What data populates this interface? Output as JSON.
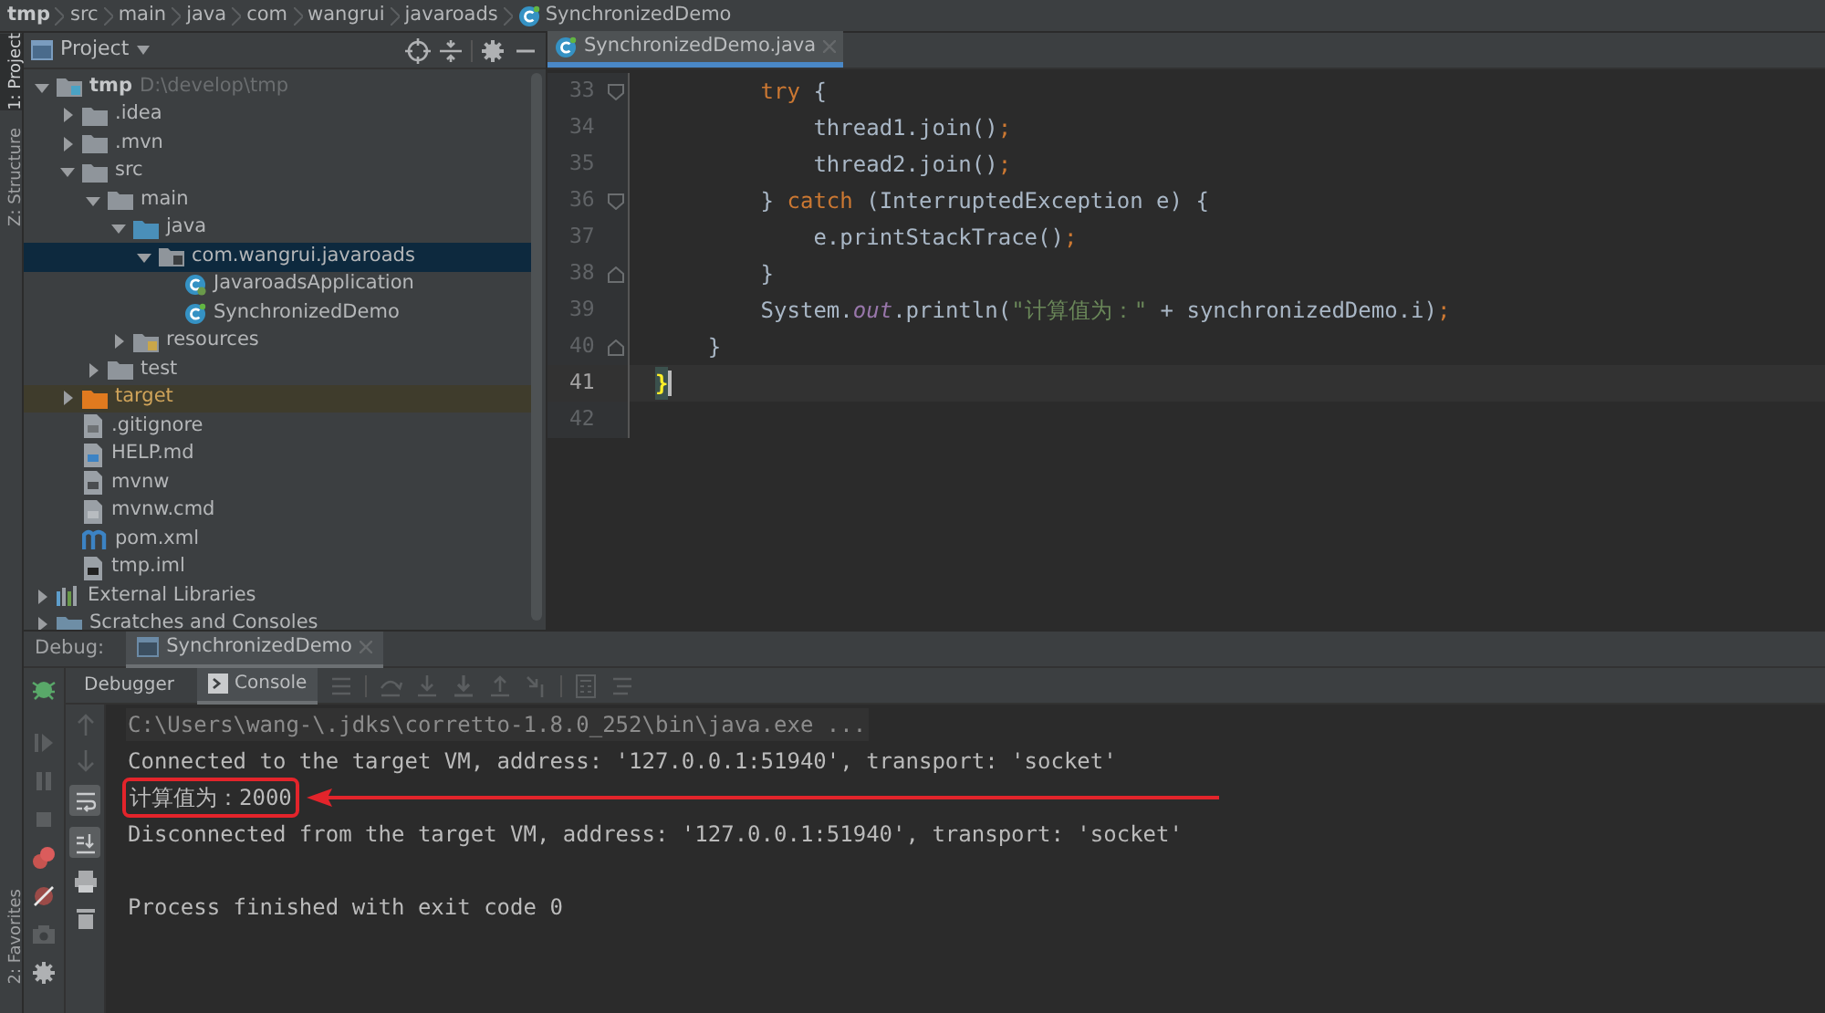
{
  "breadcrumbs": [
    {
      "label": "tmp",
      "kind": "root"
    },
    {
      "label": "src",
      "kind": "folder"
    },
    {
      "label": "main",
      "kind": "folder"
    },
    {
      "label": "java",
      "kind": "folder"
    },
    {
      "label": "com",
      "kind": "folder"
    },
    {
      "label": "wangrui",
      "kind": "folder"
    },
    {
      "label": "javaroads",
      "kind": "folder"
    },
    {
      "label": "SynchronizedDemo",
      "kind": "class"
    }
  ],
  "tool_strip": {
    "top": [
      {
        "label": "1: Project",
        "selected": true
      },
      {
        "label": "Z: Structure",
        "selected": false
      }
    ],
    "bottom": [
      {
        "label": "2: Favorites",
        "selected": false
      }
    ]
  },
  "project": {
    "title": "Project",
    "tree": [
      {
        "label": "tmp",
        "hint": "D:\\develop\\tmp",
        "kind": "module",
        "expanded": true,
        "selected": false,
        "children": [
          {
            "label": ".idea",
            "kind": "folder",
            "expanded": false,
            "selected": false
          },
          {
            "label": ".mvn",
            "kind": "folder",
            "expanded": false,
            "selected": false
          },
          {
            "label": "src",
            "kind": "folder",
            "expanded": true,
            "selected": false,
            "children": [
              {
                "label": "main",
                "kind": "folder",
                "expanded": true,
                "selected": false,
                "children": [
                  {
                    "label": "java",
                    "kind": "source",
                    "expanded": true,
                    "selected": false,
                    "children": [
                      {
                        "label": "com.wangrui.javaroads",
                        "kind": "package",
                        "expanded": true,
                        "selected": true,
                        "children": [
                          {
                            "label": "JavaroadsApplication",
                            "kind": "app-class",
                            "selected": false
                          },
                          {
                            "label": "SynchronizedDemo",
                            "kind": "class",
                            "selected": false
                          }
                        ]
                      }
                    ]
                  },
                  {
                    "label": "resources",
                    "kind": "resources",
                    "expanded": false,
                    "selected": false
                  }
                ]
              },
              {
                "label": "test",
                "kind": "folder",
                "expanded": false,
                "selected": false
              }
            ]
          },
          {
            "label": "target",
            "kind": "excluded",
            "expanded": false,
            "selected": false
          },
          {
            "label": ".gitignore",
            "kind": "ignore-file",
            "selected": false
          },
          {
            "label": "HELP.md",
            "kind": "markdown-file",
            "selected": false
          },
          {
            "label": "mvnw",
            "kind": "shell-file",
            "selected": false
          },
          {
            "label": "mvnw.cmd",
            "kind": "text-file",
            "selected": false
          },
          {
            "label": "pom.xml",
            "kind": "maven-file",
            "selected": false
          },
          {
            "label": "tmp.iml",
            "kind": "iml-file",
            "selected": false
          }
        ]
      },
      {
        "label": "External Libraries",
        "kind": "libraries",
        "expanded": false,
        "selected": false
      },
      {
        "label": "Scratches and Consoles",
        "kind": "scratches",
        "expanded": false,
        "selected": false
      }
    ]
  },
  "editor": {
    "tabs": [
      {
        "label": "SynchronizedDemo.java",
        "selected": true
      }
    ],
    "lines": [
      {
        "number": "33",
        "kind": "fold-start",
        "current": false,
        "tokens": [
          {
            "kind": "keyword",
            "text": "        try"
          },
          {
            "kind": "plain",
            "text": " {"
          }
        ]
      },
      {
        "number": "34",
        "kind": "plain",
        "current": false,
        "tokens": [
          {
            "kind": "plain",
            "text": "            thread1.join()"
          },
          {
            "kind": "keyword",
            "text": ";"
          }
        ]
      },
      {
        "number": "35",
        "kind": "plain",
        "current": false,
        "tokens": [
          {
            "kind": "plain",
            "text": "            thread2.join()"
          },
          {
            "kind": "keyword",
            "text": ";"
          }
        ]
      },
      {
        "number": "36",
        "kind": "fold-start",
        "current": false,
        "tokens": [
          {
            "kind": "plain",
            "text": "        } "
          },
          {
            "kind": "keyword",
            "text": "catch"
          },
          {
            "kind": "plain",
            "text": " (InterruptedException e) {"
          }
        ]
      },
      {
        "number": "37",
        "kind": "plain",
        "current": false,
        "tokens": [
          {
            "kind": "plain",
            "text": "            e.printStackTrace()"
          },
          {
            "kind": "keyword",
            "text": ";"
          }
        ]
      },
      {
        "number": "38",
        "kind": "fold-end",
        "current": false,
        "tokens": [
          {
            "kind": "plain",
            "text": "        }"
          }
        ]
      },
      {
        "number": "39",
        "kind": "plain",
        "current": false,
        "tokens": [
          {
            "kind": "plain",
            "text": "        System."
          },
          {
            "kind": "static",
            "text": "out"
          },
          {
            "kind": "plain",
            "text": ".println("
          },
          {
            "kind": "string",
            "text": "\"计算值为：\""
          },
          {
            "kind": "plain",
            "text": " + synchronizedDemo.i)"
          },
          {
            "kind": "keyword",
            "text": ";"
          }
        ]
      },
      {
        "number": "40",
        "kind": "fold-end",
        "current": false,
        "tokens": [
          {
            "kind": "plain",
            "text": "    }"
          }
        ]
      },
      {
        "number": "41",
        "kind": "plain",
        "current": true,
        "tokens": [
          {
            "kind": "brace-match",
            "text": "}"
          }
        ]
      },
      {
        "number": "42",
        "kind": "plain",
        "current": false
      }
    ]
  },
  "debug": {
    "label": "Debug:",
    "session": "SynchronizedDemo",
    "tabs": [
      {
        "label": "Debugger",
        "selected": false
      },
      {
        "label": "Console",
        "selected": true
      }
    ],
    "console": [
      {
        "kind": "command",
        "text": "C:\\Users\\wang-\\.jdks\\corretto-1.8.0_252\\bin\\java.exe ...",
        "boxed": false
      },
      {
        "kind": "output",
        "text": "Connected to the target VM, address: '127.0.0.1:51940', transport: 'socket'",
        "boxed": false
      },
      {
        "kind": "output",
        "text": "计算值为：2000",
        "boxed": true
      },
      {
        "kind": "output",
        "text": "Disconnected from the target VM, address: '127.0.0.1:51940', transport: 'socket'",
        "boxed": false
      },
      {
        "kind": "blank"
      },
      {
        "kind": "output",
        "text": "Process finished with exit code 0",
        "boxed": false
      }
    ]
  }
}
